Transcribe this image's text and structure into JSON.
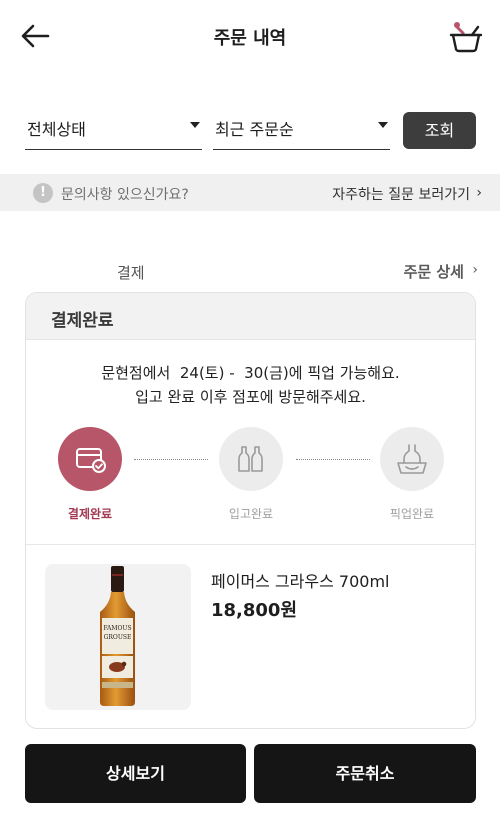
{
  "header": {
    "title": "주문 내역",
    "back_icon": "arrow-left-icon",
    "cart_icon": "shopping-basket-icon"
  },
  "filters": {
    "status_value": "전체상태",
    "sort_value": "최근 주문순",
    "search_label": "조회"
  },
  "inquiry": {
    "icon_glyph": "!",
    "text": "문의사항 있으신가요?",
    "faq_label": "자주하는 질문 보러가기",
    "chevron": "›"
  },
  "order": {
    "payment_label": "결제",
    "detail_link": "주문 상세",
    "chevron": "›",
    "status_title": "결제완료",
    "pickup_line1": "문현점에서  24(토) -  30(금)에 픽업 가능해요.",
    "pickup_line2": "입고 완료 이후 점포에 방문해주세요.",
    "steps": [
      {
        "label": "결제완료",
        "icon": "card-check-icon",
        "active": true
      },
      {
        "label": "입고완료",
        "icon": "bottles-icon",
        "active": false
      },
      {
        "label": "픽업완료",
        "icon": "bag-icon",
        "active": false
      }
    ],
    "product": {
      "name": "페이머스 그라우스 700ml",
      "price": "18,800원",
      "bottle_label_line1": "FAMOUS",
      "bottle_label_line2": "GROUSE"
    }
  },
  "actions": {
    "detail_button": "상세보기",
    "cancel_button": "주문취소"
  },
  "colors": {
    "accent": "#b75669",
    "accent_text": "#a23a52",
    "dark_button": "#151515"
  }
}
